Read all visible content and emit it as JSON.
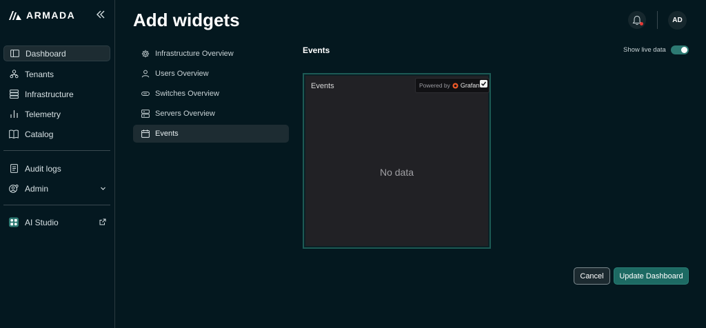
{
  "brand": {
    "name": "ARMADA"
  },
  "sidebar": {
    "primary": [
      {
        "label": "Dashboard",
        "icon": "dashboard-icon",
        "active": true
      },
      {
        "label": "Tenants",
        "icon": "tenants-icon"
      },
      {
        "label": "Infrastructure",
        "icon": "infrastructure-icon"
      },
      {
        "label": "Telemetry",
        "icon": "telemetry-icon"
      },
      {
        "label": "Catalog",
        "icon": "catalog-icon"
      }
    ],
    "secondary": [
      {
        "label": "Audit logs",
        "icon": "audit-logs-icon"
      },
      {
        "label": "Admin",
        "icon": "admin-icon"
      }
    ],
    "tertiary": [
      {
        "label": "AI Studio",
        "icon": "ai-studio-icon"
      }
    ]
  },
  "header": {
    "title": "Add widgets",
    "avatar_initials": "AD"
  },
  "widgets": [
    {
      "label": "Infrastructure Overview",
      "icon": "gear-icon"
    },
    {
      "label": "Users Overview",
      "icon": "user-icon"
    },
    {
      "label": "Switches Overview",
      "icon": "switch-icon"
    },
    {
      "label": "Servers Overview",
      "icon": "server-icon"
    },
    {
      "label": "Events",
      "icon": "calendar-icon",
      "active": true
    }
  ],
  "preview": {
    "section_title": "Events",
    "live_label": "Show live data",
    "live_on": true,
    "panel_title": "Events",
    "powered_by": "Powered by",
    "powered_brand": "Grafan",
    "empty_text": "No data"
  },
  "actions": {
    "cancel_label": "Cancel",
    "update_label": "Update Dashboard"
  },
  "colors": {
    "background": "#04181f",
    "accent": "#1d6a63",
    "toggle_on": "#2d7a73",
    "panel_border": "#1c5a54",
    "notification_dot": "#e53935"
  }
}
